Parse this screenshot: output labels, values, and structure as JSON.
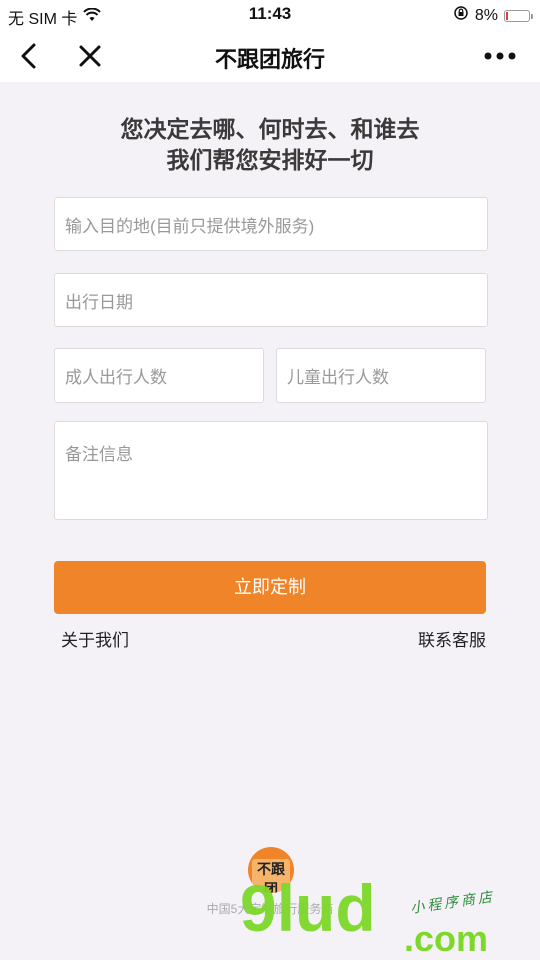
{
  "status_bar": {
    "carrier": "无 SIM 卡",
    "time": "11:43",
    "battery_percent": "8%",
    "battery_level": 0.08,
    "battery_color": "#e23b3b"
  },
  "nav": {
    "title": "不跟团旅行",
    "back_icon": "chevron-left-icon",
    "close_icon": "close-icon",
    "more_icon": "more-dots-icon"
  },
  "headline": {
    "line1": "您决定去哪、何时去、和谁去",
    "line2": "我们帮您安排好一切"
  },
  "form": {
    "destination_placeholder": "输入目的地(目前只提供境外服务)",
    "date_placeholder": "出行日期",
    "adults_placeholder": "成人出行人数",
    "children_placeholder": "儿童出行人数",
    "notes_placeholder": "备注信息"
  },
  "actions": {
    "submit_label": "立即定制",
    "about_label": "关于我们",
    "contact_label": "联系客服"
  },
  "footer": {
    "logo_text": "不跟团",
    "tagline": "中国5大定制旅行服务商"
  },
  "watermark": {
    "big": "9lud",
    "com": ".com",
    "small": "小程序商店"
  },
  "colors": {
    "accent": "#ef8428",
    "background": "#f4f2f7"
  }
}
